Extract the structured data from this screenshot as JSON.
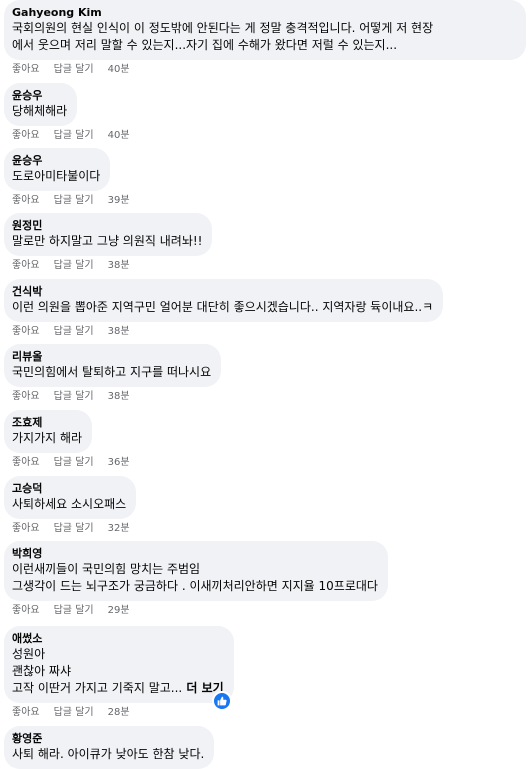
{
  "comments": [
    {
      "author": "Gahyeong Kim",
      "text": "국회의원의 현실 인식이 이 정도밖에 안된다는 게 정말 충격적입니다. 어떻게 저 현장\n에서 웃으며 저리 말할 수 있는지...자기 집에 수해가 왔다면 저럴 수 있는지...",
      "like": "좋아요",
      "reply": "답글 달기",
      "time": "40분"
    },
    {
      "author": "윤승우",
      "text": "당해체해라",
      "like": "좋아요",
      "reply": "답글 달기",
      "time": "40분"
    },
    {
      "author": "윤승우",
      "text": "도로아미타불이다",
      "like": "좋아요",
      "reply": "답글 달기",
      "time": "39분"
    },
    {
      "author": "원정민",
      "text": "말로만 하지말고 그냥 의원직 내려놔!!",
      "like": "좋아요",
      "reply": "답글 달기",
      "time": "38분"
    },
    {
      "author": "건식박",
      "text": "이런 의원을 뽑아준 지역구민 얼어분 대단히 좋으시겠습니다.. 지역자랑 듁이내요..ㅋ",
      "like": "좋아요",
      "reply": "답글 달기",
      "time": "38분"
    },
    {
      "author": "리뷰올",
      "text": "국민의힘에서 탈퇴하고 지구를 떠나시요",
      "like": "좋아요",
      "reply": "답글 달기",
      "time": "38분"
    },
    {
      "author": "조효제",
      "text": "가지가지 해라",
      "like": "좋아요",
      "reply": "답글 달기",
      "time": "36분"
    },
    {
      "author": "고승덕",
      "text": "사퇴하세요 소시오패스",
      "like": "좋아요",
      "reply": "답글 달기",
      "time": "32분"
    },
    {
      "author": "박희영",
      "text": "이런새끼들이 국민의힘 망치는 주범임\n그생각이 드는 뇌구조가 궁금하다 . 이새끼처리안하면 지지율 10프로대다",
      "like": "좋아요",
      "reply": "답글 달기",
      "time": "29분"
    },
    {
      "author": "애썼소",
      "text": "성원아\n괜찮아 짜샤\n고작 이딴거 가지고 기죽지 말고...",
      "more": " 더 보기",
      "like": "좋아요",
      "reply": "답글 달기",
      "time": "28분"
    },
    {
      "author": "황영준",
      "text": "사퇴 해라. 아이큐가 낮아도 한참 낮다."
    }
  ]
}
